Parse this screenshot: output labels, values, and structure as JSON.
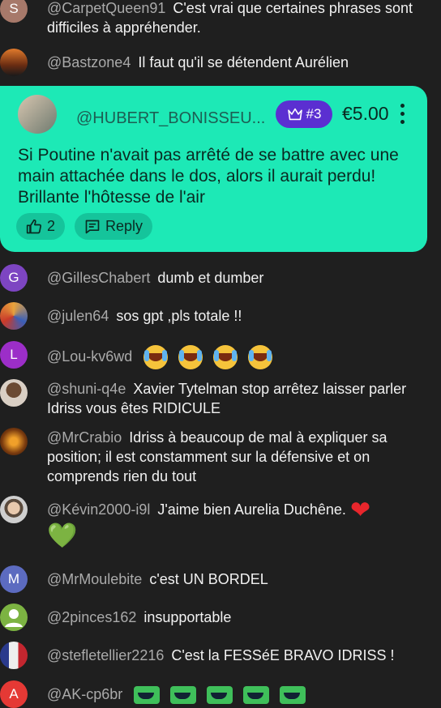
{
  "messages_top": [
    {
      "author": "@CarpetQueen91",
      "text": "C'est vrai que certaines phrases sont difficiles à appréhender.",
      "avatar_letter": "S",
      "avatar_color": "#a7796a"
    },
    {
      "author": "@Bastzone4",
      "text": "Il faut qu'il se détendent Aurélien",
      "avatar_letter": "",
      "avatar_color": "#c4622a"
    }
  ],
  "super_chat": {
    "author": "@HUBERT_BONISSEU...",
    "rank": "#3",
    "amount": "€5.00",
    "text": "Si Poutine n'avait pas arrêté de se battre avec une main attachée dans le dos, alors il aurait perdu! Brillante l'hôtesse de l'air",
    "likes": "2",
    "reply_label": "Reply",
    "bg_color": "#1de9b6"
  },
  "messages": [
    {
      "author": "@GillesChabert",
      "text": "dumb et dumber",
      "avatar_letter": "G",
      "avatar_color": "#7d45c2"
    },
    {
      "author": "@julen64",
      "text": "sos gpt ,pls totale !!",
      "avatar_letter": "",
      "avatar_color": "#d0892c"
    },
    {
      "author": "@Lou-kv6wd",
      "text": "",
      "avatar_letter": "L",
      "avatar_color": "#9c2ec8"
    },
    {
      "author": "@shuni-q4e",
      "text": "Xavier Tytelman stop arrêtez laisser parler Idriss vous êtes RIDICULE",
      "avatar_letter": "",
      "avatar_color": "#b89b83"
    },
    {
      "author": "@MrCrabio",
      "text": "Idriss à beaucoup de mal à expliquer sa position; il est constamment sur la défensive et on comprends rien du tout",
      "avatar_letter": "",
      "avatar_color": "#9c5a1c"
    },
    {
      "author": "@Kévin2000-i9l",
      "text": "J'aime bien Aurelia Duchêne.",
      "avatar_letter": "",
      "avatar_color": "#8a8a8a"
    },
    {
      "author": "@MrMoulebite",
      "text": "c'est UN BORDEL",
      "avatar_letter": "M",
      "avatar_color": "#5c6bc0"
    },
    {
      "author": "@2pinces162",
      "text": "insupportable",
      "avatar_letter": "",
      "avatar_color": "#7cb342"
    },
    {
      "author": "@stefletellier2216",
      "text": "C'est la FESSéE BRAVO IDRISS !",
      "avatar_letter": "",
      "avatar_color": "#3f51b5"
    },
    {
      "author": "@AK-cp6br",
      "text": "",
      "avatar_letter": "A",
      "avatar_color": "#e53935"
    }
  ],
  "emoji": {
    "heart_red": "❤",
    "heart_green": "💚"
  }
}
